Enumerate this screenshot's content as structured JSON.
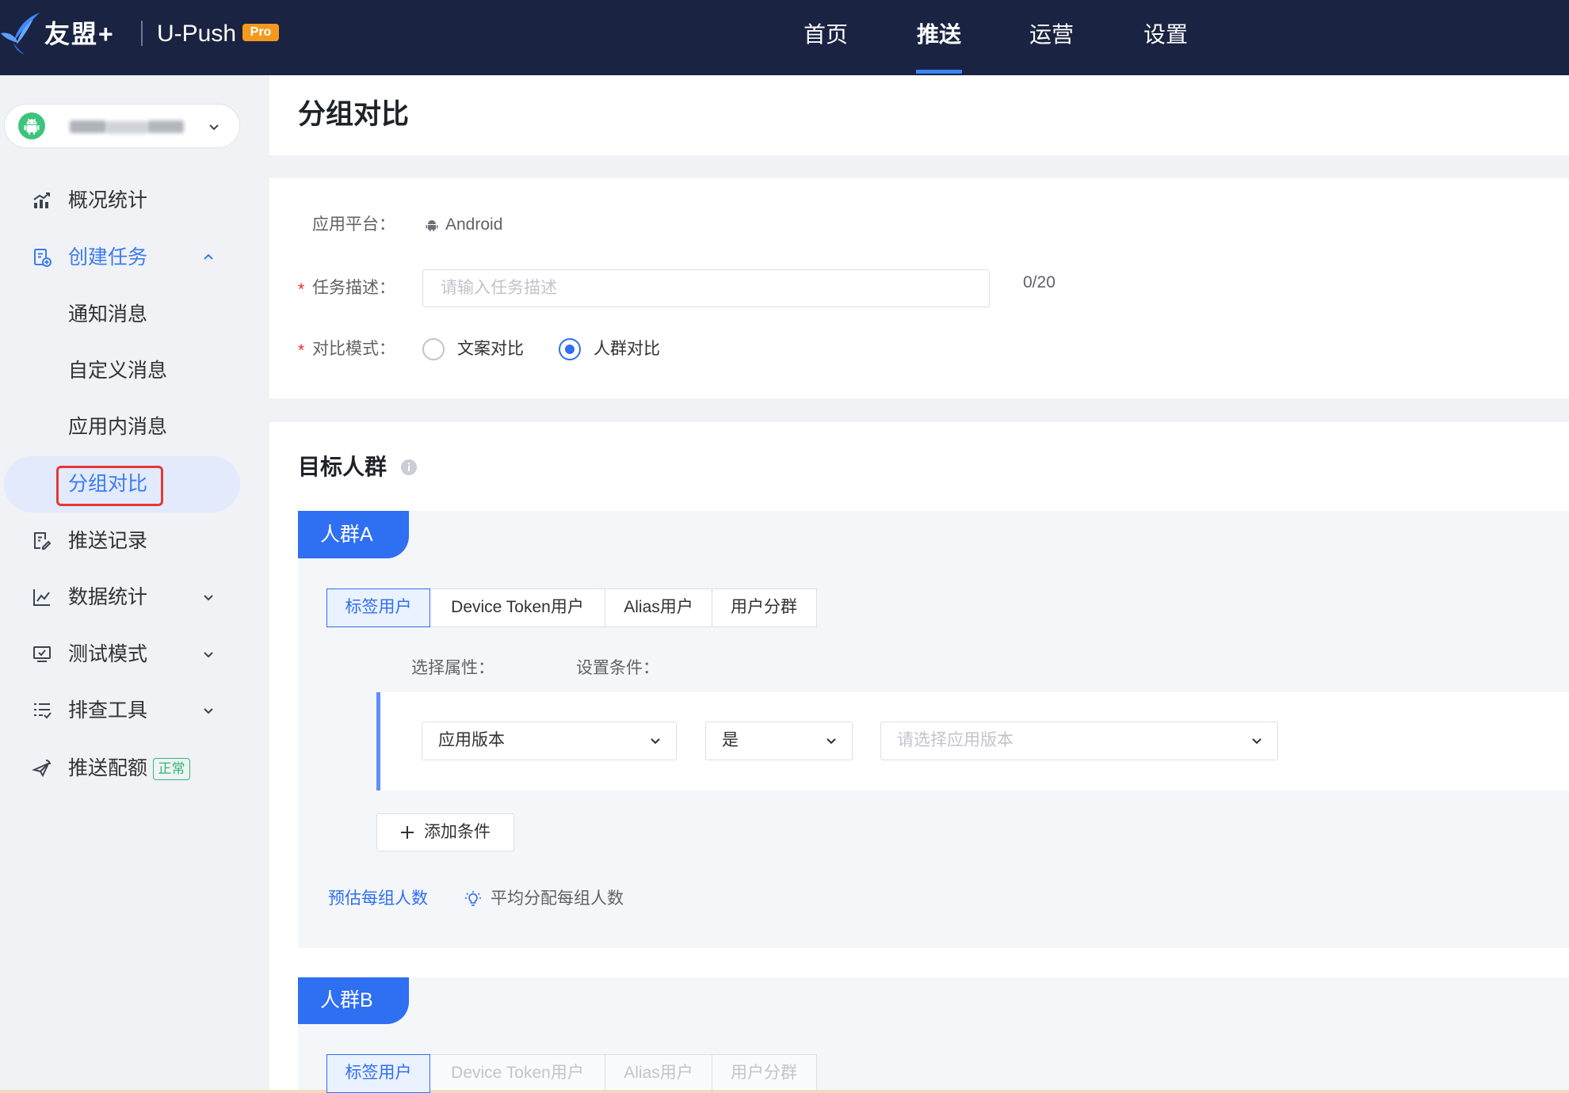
{
  "colors": {
    "nav_bg": "#1a2341",
    "accent": "#2f6ff2",
    "required": "#f5222d",
    "highlight_box": "#e53935",
    "status_ok": "#2eb872",
    "pro_badge": "#f39a1e"
  },
  "nav": {
    "logo_icon": "umeng-bird-logo-icon",
    "brand": "友盟+",
    "product": "U-Push",
    "badge": "Pro",
    "items": [
      {
        "label": "首页",
        "active": false
      },
      {
        "label": "推送",
        "active": true
      },
      {
        "label": "运营",
        "active": false
      },
      {
        "label": "设置",
        "active": false
      }
    ]
  },
  "app_selector": {
    "platform_icon": "android-icon"
  },
  "sidebar": {
    "overview": {
      "label": "概况统计",
      "icon": "chart-trend-icon"
    },
    "create_task": {
      "label": "创建任务",
      "icon": "document-add-icon",
      "expanded": true,
      "children": [
        {
          "label": "通知消息",
          "active": false
        },
        {
          "label": "自定义消息",
          "active": false
        },
        {
          "label": "应用内消息",
          "active": false
        },
        {
          "label": "分组对比",
          "active": true
        }
      ]
    },
    "push_records": {
      "label": "推送记录",
      "icon": "document-edit-icon"
    },
    "data_stats": {
      "label": "数据统计",
      "icon": "line-chart-icon"
    },
    "test_mode": {
      "label": "测试模式",
      "icon": "monitor-check-icon"
    },
    "troubleshoot": {
      "label": "排查工具",
      "icon": "list-check-icon"
    },
    "quota": {
      "label": "推送配额",
      "icon": "send-icon",
      "status": "正常"
    }
  },
  "page": {
    "title": "分组对比"
  },
  "form": {
    "required_mark": "*",
    "platform": {
      "label": "应用平台：",
      "value": "Android",
      "icon": "android-icon"
    },
    "description": {
      "label": "任务描述：",
      "placeholder": "请输入任务描述",
      "value": "",
      "counter": "0/20"
    },
    "mode": {
      "label": "对比模式：",
      "options": [
        {
          "label": "文案对比",
          "checked": false
        },
        {
          "label": "人群对比",
          "checked": true
        }
      ]
    }
  },
  "target": {
    "title": "目标人群",
    "groups": [
      {
        "name": "人群A",
        "tabs": [
          {
            "label": "标签用户",
            "active": true
          },
          {
            "label": "Device Token用户",
            "active": false
          },
          {
            "label": "Alias用户",
            "active": false
          },
          {
            "label": "用户分群",
            "active": false
          }
        ],
        "attribute_label": "选择属性：",
        "condition_label": "设置条件：",
        "condition": {
          "attribute": "应用版本",
          "operator": "是",
          "value": "",
          "value_placeholder": "请选择应用版本"
        },
        "add_condition": "添加条件",
        "estimate_link": "预估每组人数",
        "average_label": "平均分配每组人数"
      },
      {
        "name": "人群B",
        "tabs": [
          {
            "label": "标签用户",
            "active": true,
            "disabled": false
          },
          {
            "label": "Device Token用户",
            "active": false,
            "disabled": true
          },
          {
            "label": "Alias用户",
            "active": false,
            "disabled": true
          },
          {
            "label": "用户分群",
            "active": false,
            "disabled": true
          }
        ]
      }
    ]
  }
}
